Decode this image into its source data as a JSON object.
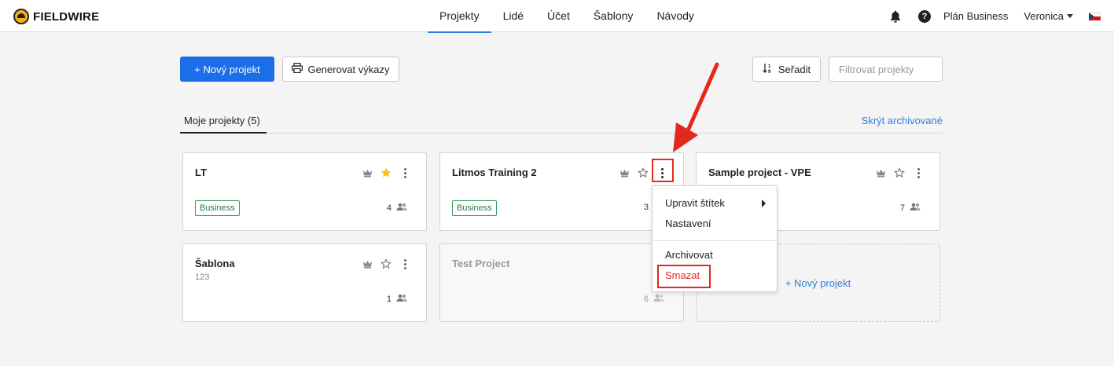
{
  "app": {
    "logo_text": "FIELDWIRE"
  },
  "nav": {
    "tabs": [
      {
        "label": "Projekty",
        "active": true
      },
      {
        "label": "Lidé"
      },
      {
        "label": "Účet"
      },
      {
        "label": "Šablony"
      },
      {
        "label": "Návody"
      }
    ],
    "help_label": "?",
    "plan_label": "Plán Business",
    "user_label": "Veronica",
    "icons": [
      "bell-icon",
      "help-icon",
      "chevron-down-icon",
      "czech-flag-icon"
    ]
  },
  "toolbar": {
    "new_project_label": "+ Nový projekt",
    "generate_reports_label": "Generovat výkazy",
    "sort_label": "Seřadit",
    "filter_placeholder": "Filtrovat projekty"
  },
  "section": {
    "tab_label": "Moje projekty (5)",
    "hide_archived_label": "Skrýt archivované"
  },
  "projects": [
    {
      "title": "LT",
      "subtitle": "",
      "badge": "Business",
      "members": "4",
      "starred": true,
      "dimmed": false
    },
    {
      "title": "Litmos Training 2",
      "subtitle": "",
      "badge": "Business",
      "members": "3",
      "starred": false,
      "dimmed": false
    },
    {
      "title": "Sample project - VPE",
      "subtitle": "",
      "badge": "",
      "members": "7",
      "starred": false,
      "dimmed": false
    },
    {
      "title": "Šablona",
      "subtitle": "123",
      "badge": "",
      "members": "1",
      "starred": false,
      "dimmed": false
    },
    {
      "title": "Test Project",
      "subtitle": "",
      "badge": "",
      "members": "6",
      "starred": false,
      "dimmed": true
    }
  ],
  "new_project_card_label": "+ Nový projekt",
  "context_menu": {
    "items": [
      {
        "label": "Upravit štítek",
        "has_submenu": true
      },
      {
        "label": "Nastavení"
      },
      {
        "label": "Archivovat"
      },
      {
        "label": "Smazat",
        "danger": true
      }
    ]
  },
  "colors": {
    "primary": "#1a6ee8",
    "link": "#2f7de1",
    "badge_green": "#2f9e5a",
    "star_gold": "#f5c518",
    "annotation_red": "#e3291c"
  }
}
